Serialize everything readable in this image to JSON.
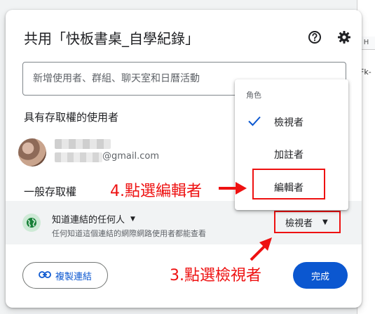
{
  "dialog": {
    "title": "共用「快板書桌_自學紀錄」",
    "add_people_placeholder": "新增使用者、群組、聊天室和日曆活動",
    "people_with_access_heading": "具有存取權的使用者",
    "user": {
      "email_suffix": "@gmail.com"
    },
    "general_access_heading": "一般存取權",
    "general_access": {
      "scope_label": "知道連結的任何人",
      "description": "任何知道這個連結的網際網路使用者都能查看",
      "role_label": "檢視者"
    },
    "copy_link_label": "複製連結",
    "done_label": "完成"
  },
  "role_menu": {
    "heading": "角色",
    "items": [
      {
        "label": "檢視者",
        "selected": true
      },
      {
        "label": "加註者",
        "selected": false
      },
      {
        "label": "編輯者",
        "selected": false
      }
    ]
  },
  "annotations": {
    "editor_note": "4.點選編輯者",
    "viewer_note": "3.點選檢視者"
  },
  "background": {
    "column_header": "H",
    "cell_text": "Fk-"
  },
  "colors": {
    "primary": "#0b57d0",
    "annotation": "#ee1111",
    "globe_bg": "#ceead6",
    "globe_fg": "#188038"
  },
  "icons": {
    "help": "help-circle-icon",
    "settings": "gear-icon",
    "globe": "globe-icon",
    "link": "link-icon",
    "check": "check-icon"
  }
}
